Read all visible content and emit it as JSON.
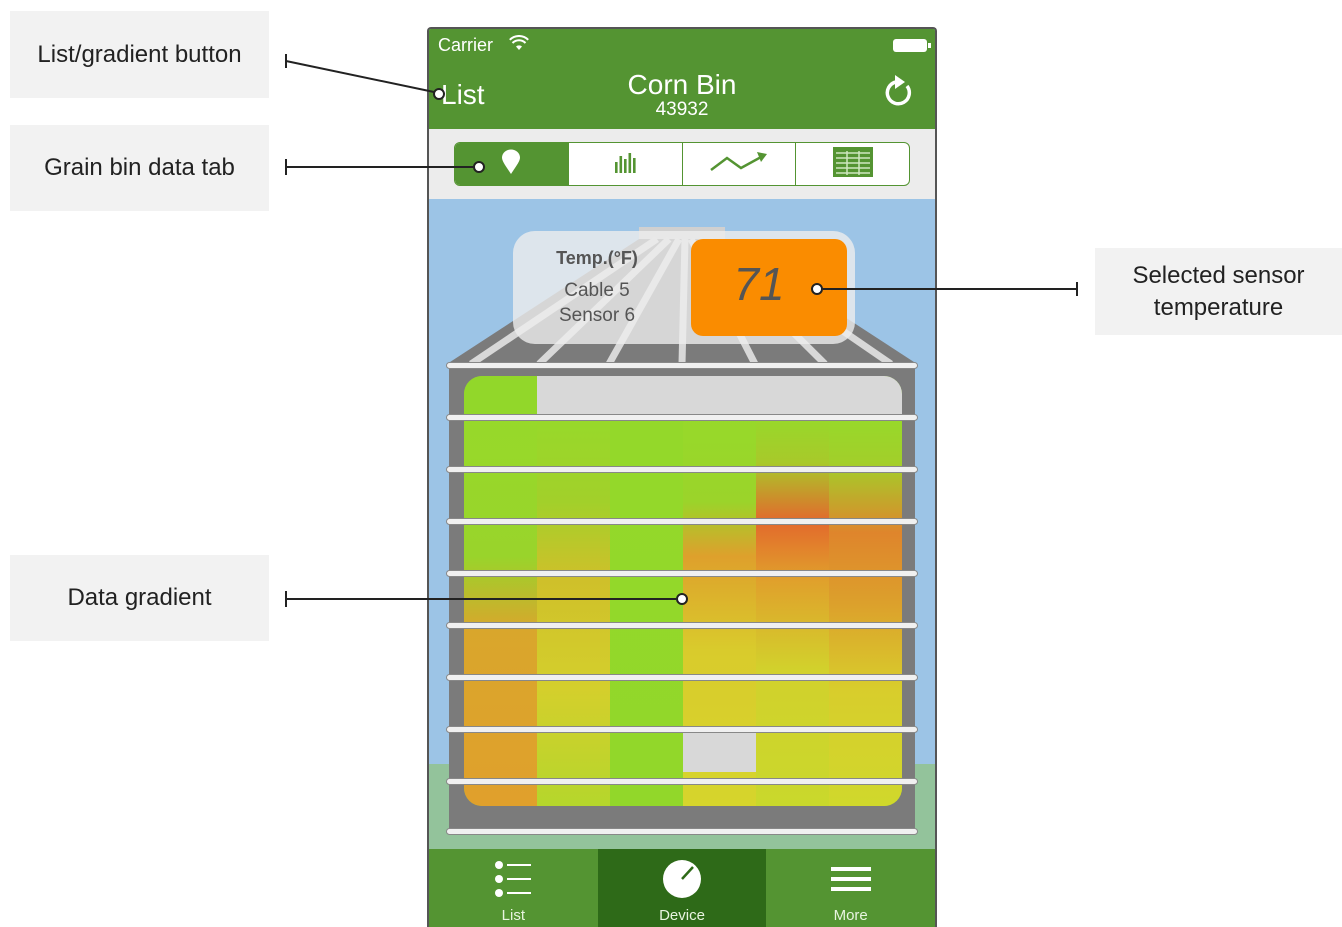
{
  "annotations": {
    "list_button": "List/gradient button",
    "data_tab": "Grain bin data tab",
    "selected_temp": "Selected sensor temperature",
    "data_gradient": "Data gradient"
  },
  "status": {
    "carrier": "Carrier"
  },
  "nav": {
    "left": "List",
    "title": "Corn Bin",
    "subtitle": "43932"
  },
  "segments": [
    {
      "icon": "map-pin-icon",
      "active": true
    },
    {
      "icon": "bar-chart-icon",
      "active": false
    },
    {
      "icon": "trend-line-icon",
      "active": false
    },
    {
      "icon": "table-icon",
      "active": false
    }
  ],
  "sensor": {
    "label": "Temp.(°F)",
    "cable": "Cable 5",
    "sensor": "Sensor 6",
    "value": "71"
  },
  "tabs": [
    {
      "label": "List",
      "icon": "list-icon",
      "active": false
    },
    {
      "label": "Device",
      "icon": "gauge-icon",
      "active": true
    },
    {
      "label": "More",
      "icon": "menu-icon",
      "active": false
    }
  ],
  "colors": {
    "brand_green": "#549432",
    "active_tab": "#2e6a18",
    "temp_box": "#fa8c00",
    "sky": "#9cc4e6"
  }
}
